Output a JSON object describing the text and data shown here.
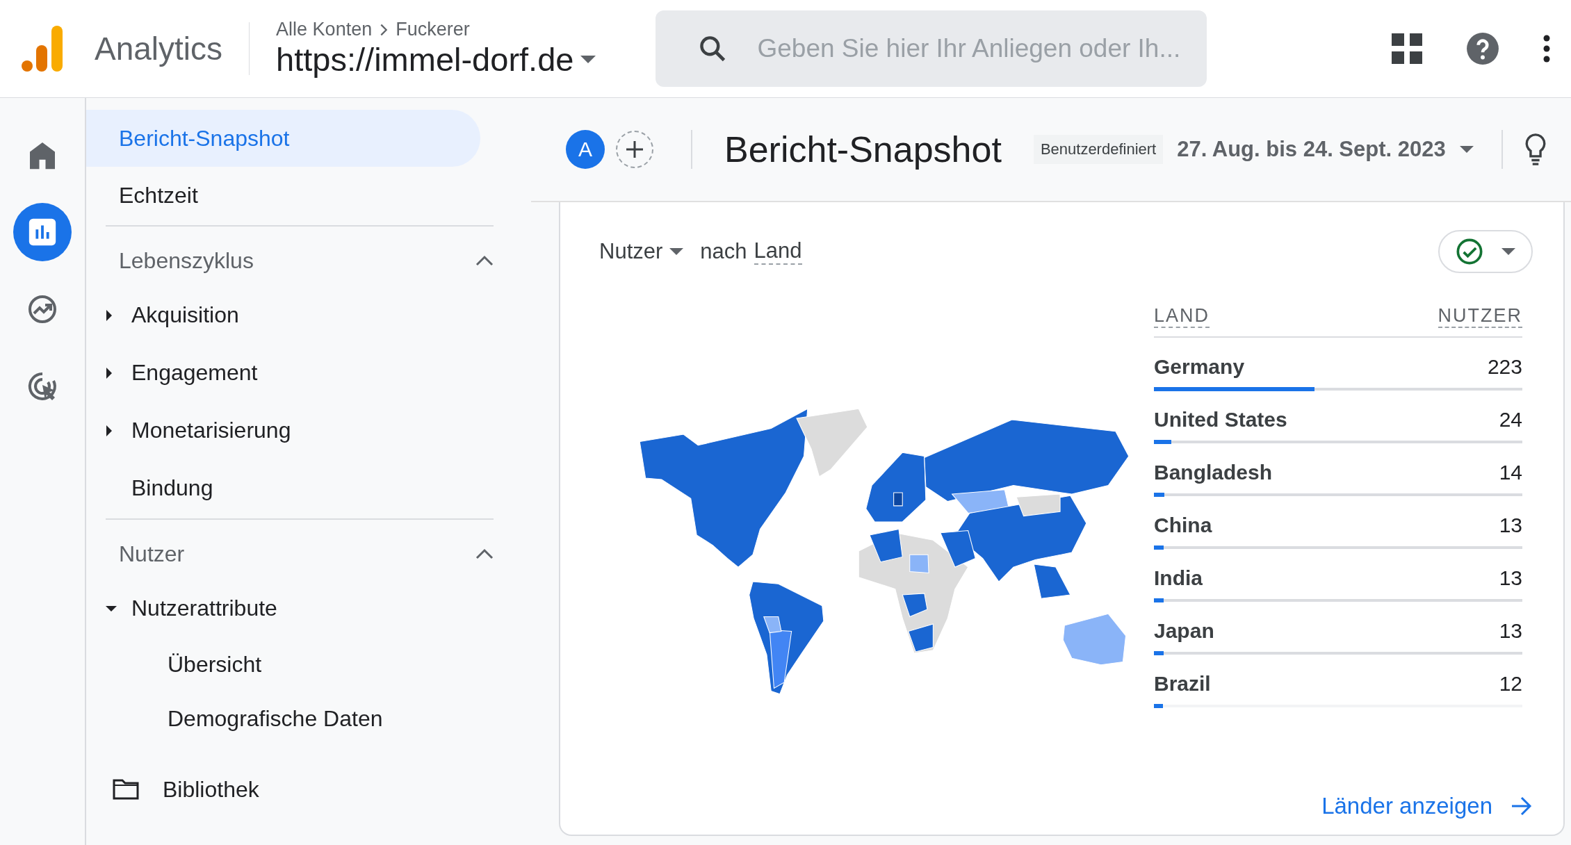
{
  "header": {
    "product": "Analytics",
    "breadcrumb": [
      "Alle Konten",
      "Fuckerer"
    ],
    "property": "https://immel-dorf.de",
    "search": {
      "placeholder": "Geben Sie hier Ihr Anliegen oder Ih..."
    }
  },
  "rail": [
    {
      "kind": "home",
      "selected": false
    },
    {
      "kind": "reports",
      "selected": true
    },
    {
      "kind": "explore",
      "selected": false
    },
    {
      "kind": "advertising",
      "selected": false
    }
  ],
  "nav": [
    {
      "kind": "link",
      "label": "Bericht-Snapshot",
      "selected": true
    },
    {
      "kind": "link",
      "label": "Echtzeit",
      "selected": false
    },
    {
      "kind": "section",
      "label": "Lebenszyklus",
      "expanded": true,
      "children": [
        {
          "label": "Akquisition",
          "expanded": false
        },
        {
          "label": "Engagement",
          "expanded": false
        },
        {
          "label": "Monetarisierung",
          "expanded": false
        },
        {
          "label": "Bindung"
        }
      ]
    },
    {
      "kind": "section",
      "label": "Nutzer",
      "expanded": true,
      "children": [
        {
          "label": "Nutzerattribute",
          "expanded": true,
          "children": [
            {
              "label": "Übersicht"
            },
            {
              "label": "Demografische Daten"
            }
          ]
        }
      ]
    }
  ],
  "library": {
    "label": "Bibliothek"
  },
  "report": {
    "title": "Bericht-Snapshot",
    "range_label": "Benutzerdefiniert",
    "date_range": "27. Aug. bis 24. Sept. 2023",
    "avatar": "A"
  },
  "card": {
    "metric": "Nutzer",
    "by": "nach",
    "dimension": "Land",
    "columns": [
      "LAND",
      "NUTZER"
    ],
    "rows": [
      {
        "country": "Germany",
        "users": "223",
        "level": 0.435
      },
      {
        "country": "United States",
        "users": "24",
        "level": 0.048
      },
      {
        "country": "Bangladesh",
        "users": "14",
        "level": 0.028
      },
      {
        "country": "China",
        "users": "13",
        "level": 0.026
      },
      {
        "country": "India",
        "users": "13",
        "level": 0.026
      },
      {
        "country": "Japan",
        "users": "13",
        "level": 0.026
      },
      {
        "country": "Brazil",
        "users": "12",
        "level": 0.024
      }
    ],
    "link": "Länder anzeigen"
  }
}
